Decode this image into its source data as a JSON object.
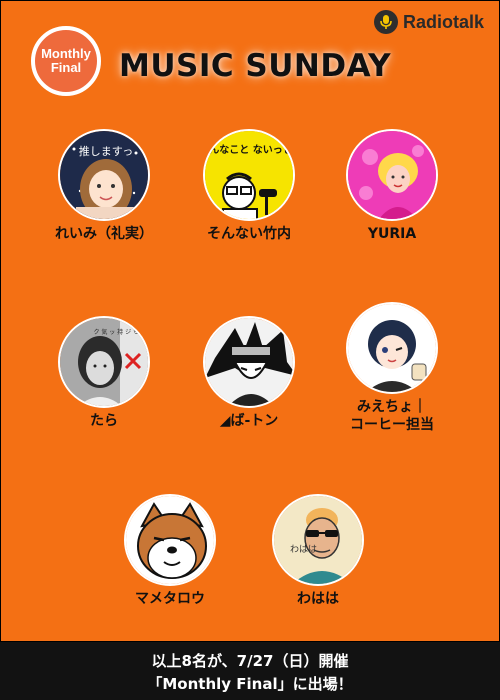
{
  "brand": {
    "logo_text": "Radiotalk"
  },
  "badge": {
    "line1": "Monthly",
    "line2": "Final"
  },
  "header": {
    "title": "MUSIC SUNDAY"
  },
  "members": [
    {
      "name": "れいみ（礼実）",
      "avatar_text": "推しますっ"
    },
    {
      "name": "そんない竹内",
      "avatar_text": "そんなこと ないっしょ"
    },
    {
      "name": "YURIA"
    },
    {
      "name": "たら",
      "avatar_text": "ク 気 ッ 持 ジ ち ラ 悪 ジ い ャ"
    },
    {
      "name": "◢ば-トン"
    },
    {
      "name": "みえちょ｜\nコーヒー担当"
    },
    {
      "name": "マメタロウ"
    },
    {
      "name": "わはは",
      "avatar_text": "わはは"
    }
  ],
  "footer": {
    "line1": "以上8名が、7/27（日）開催",
    "line2": "「Monthly Final」に出場！"
  },
  "colors": {
    "background": "#f47014",
    "badge": "#ee6a3c",
    "footer": "#121212",
    "title": "#111111"
  }
}
